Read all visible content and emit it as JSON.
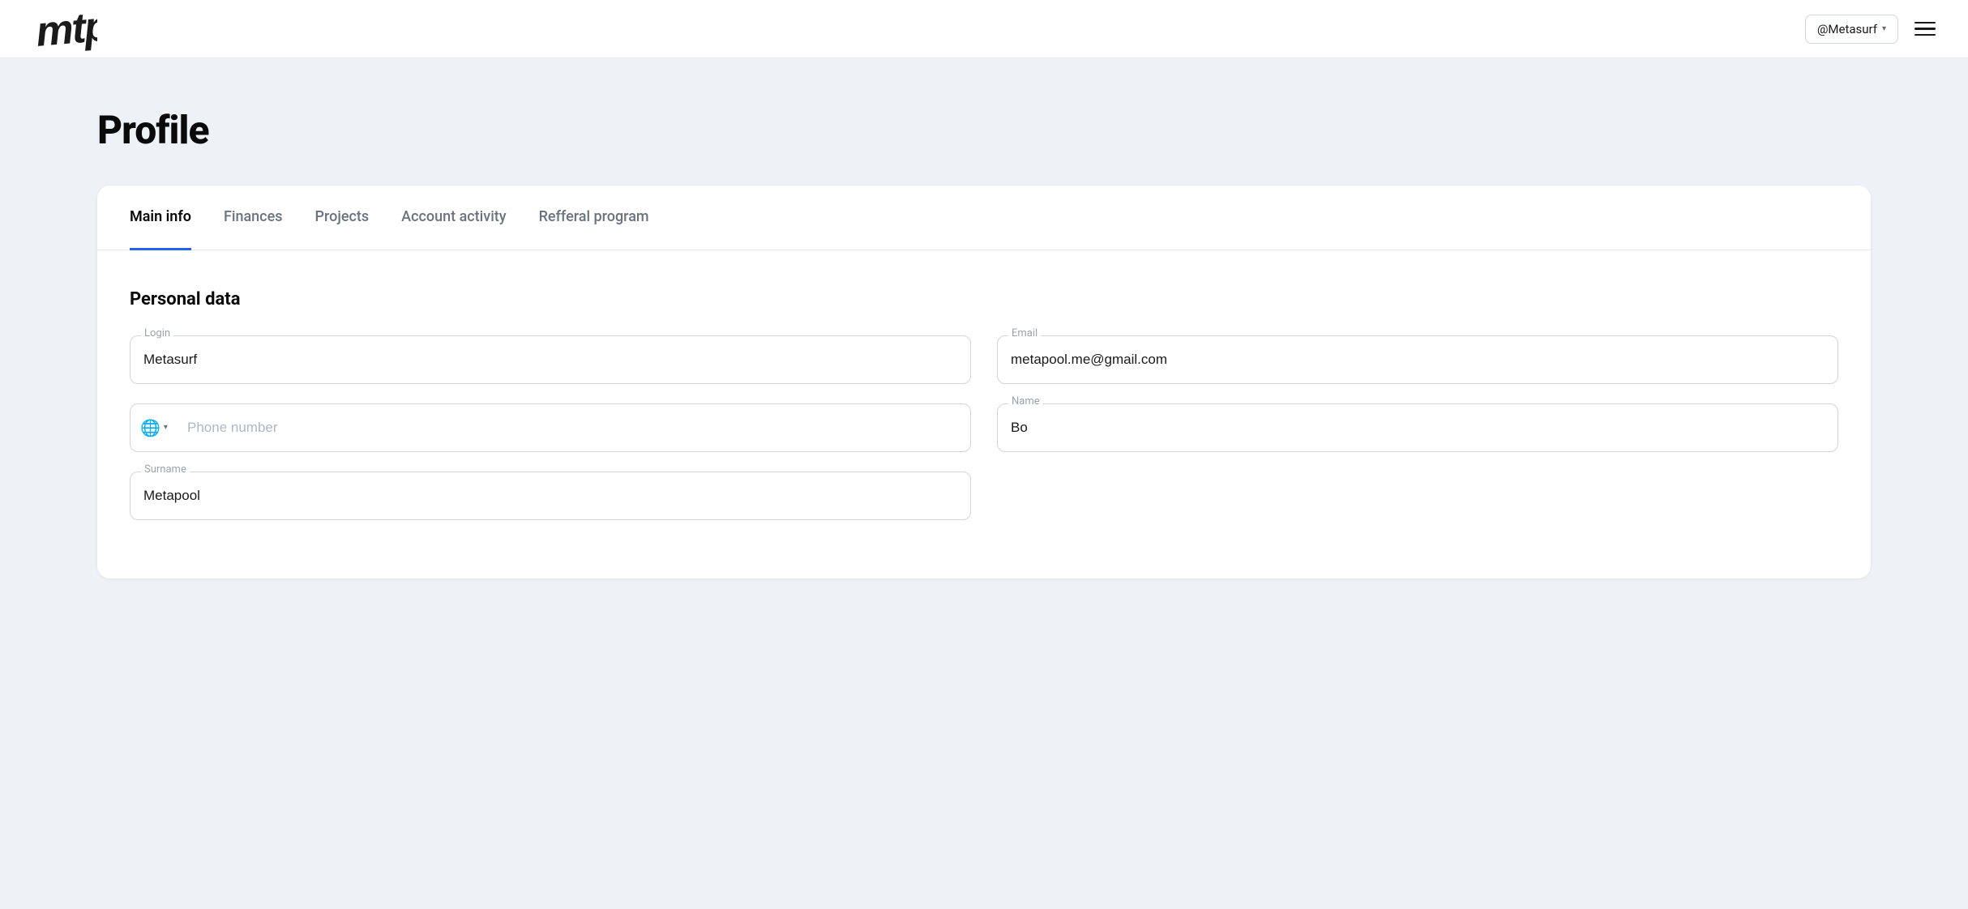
{
  "header": {
    "username": "@Metasurf",
    "dropdown_arrow": "▾"
  },
  "page": {
    "title": "Profile"
  },
  "tabs": [
    {
      "id": "main-info",
      "label": "Main info",
      "active": true
    },
    {
      "id": "finances",
      "label": "Finances",
      "active": false
    },
    {
      "id": "projects",
      "label": "Projects",
      "active": false
    },
    {
      "id": "account-activity",
      "label": "Account activity",
      "active": false
    },
    {
      "id": "referral-program",
      "label": "Refferal program",
      "active": false
    }
  ],
  "personal_data": {
    "section_title": "Personal data",
    "fields": {
      "login": {
        "label": "Login",
        "value": "Metasurf",
        "placeholder": ""
      },
      "email": {
        "label": "Email",
        "value": "metapool.me@gmail.com",
        "placeholder": ""
      },
      "phone": {
        "label": "",
        "placeholder": "Phone number"
      },
      "name": {
        "label": "Name",
        "value": "Bo",
        "placeholder": ""
      },
      "surname": {
        "label": "Surname",
        "value": "Metapool",
        "placeholder": ""
      }
    }
  }
}
